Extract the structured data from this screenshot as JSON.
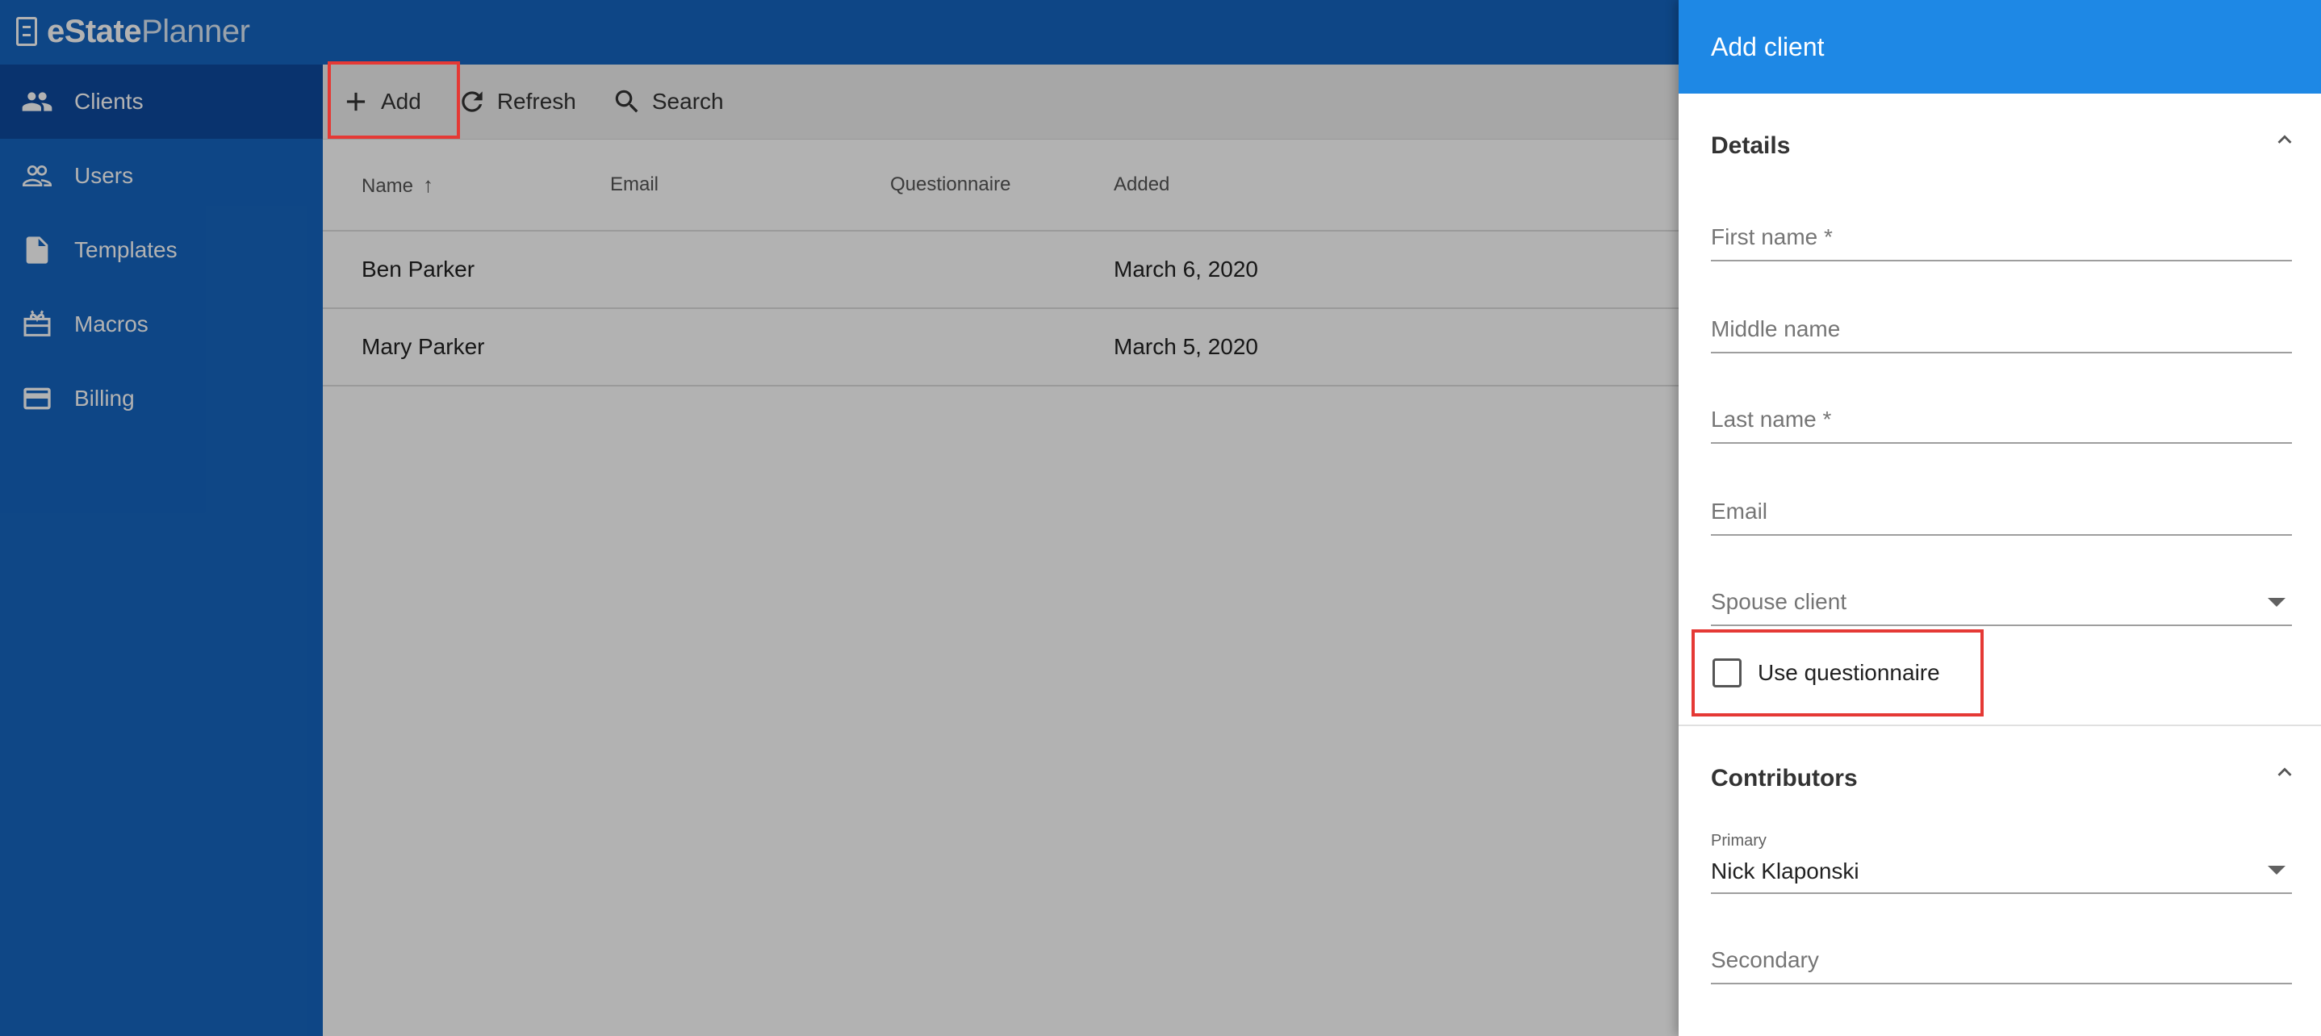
{
  "app": {
    "logo_bold": "eState",
    "logo_light": "Planner"
  },
  "sidebar": {
    "items": [
      {
        "label": "Clients",
        "icon": "people-icon",
        "active": true
      },
      {
        "label": "Users",
        "icon": "people-outline-icon"
      },
      {
        "label": "Templates",
        "icon": "document-icon"
      },
      {
        "label": "Macros",
        "icon": "macro-box-icon"
      },
      {
        "label": "Billing",
        "icon": "credit-card-icon"
      }
    ]
  },
  "toolbar": {
    "add_label": "Add",
    "refresh_label": "Refresh",
    "search_label": "Search"
  },
  "table": {
    "headers": [
      "Name",
      "Email",
      "Questionnaire",
      "Added"
    ],
    "rows": [
      {
        "name": "Ben Parker",
        "email": "",
        "questionnaire": "",
        "added": "March 6, 2020"
      },
      {
        "name": "Mary Parker",
        "email": "",
        "questionnaire": "",
        "added": "March 5, 2020"
      }
    ]
  },
  "drawer": {
    "title": "Add client",
    "details": {
      "title": "Details",
      "first_name": "First name *",
      "middle_name": "Middle name",
      "last_name": "Last name *",
      "email": "Email",
      "spouse_client": "Spouse client",
      "use_questionnaire": "Use questionnaire"
    },
    "contributors": {
      "title": "Contributors",
      "primary_label": "Primary",
      "primary_value": "Nick Klaponski",
      "secondary": "Secondary"
    }
  },
  "colors": {
    "sidebar": "#1565c0",
    "drawer_header": "#1e88e5",
    "highlight": "#e53935"
  }
}
